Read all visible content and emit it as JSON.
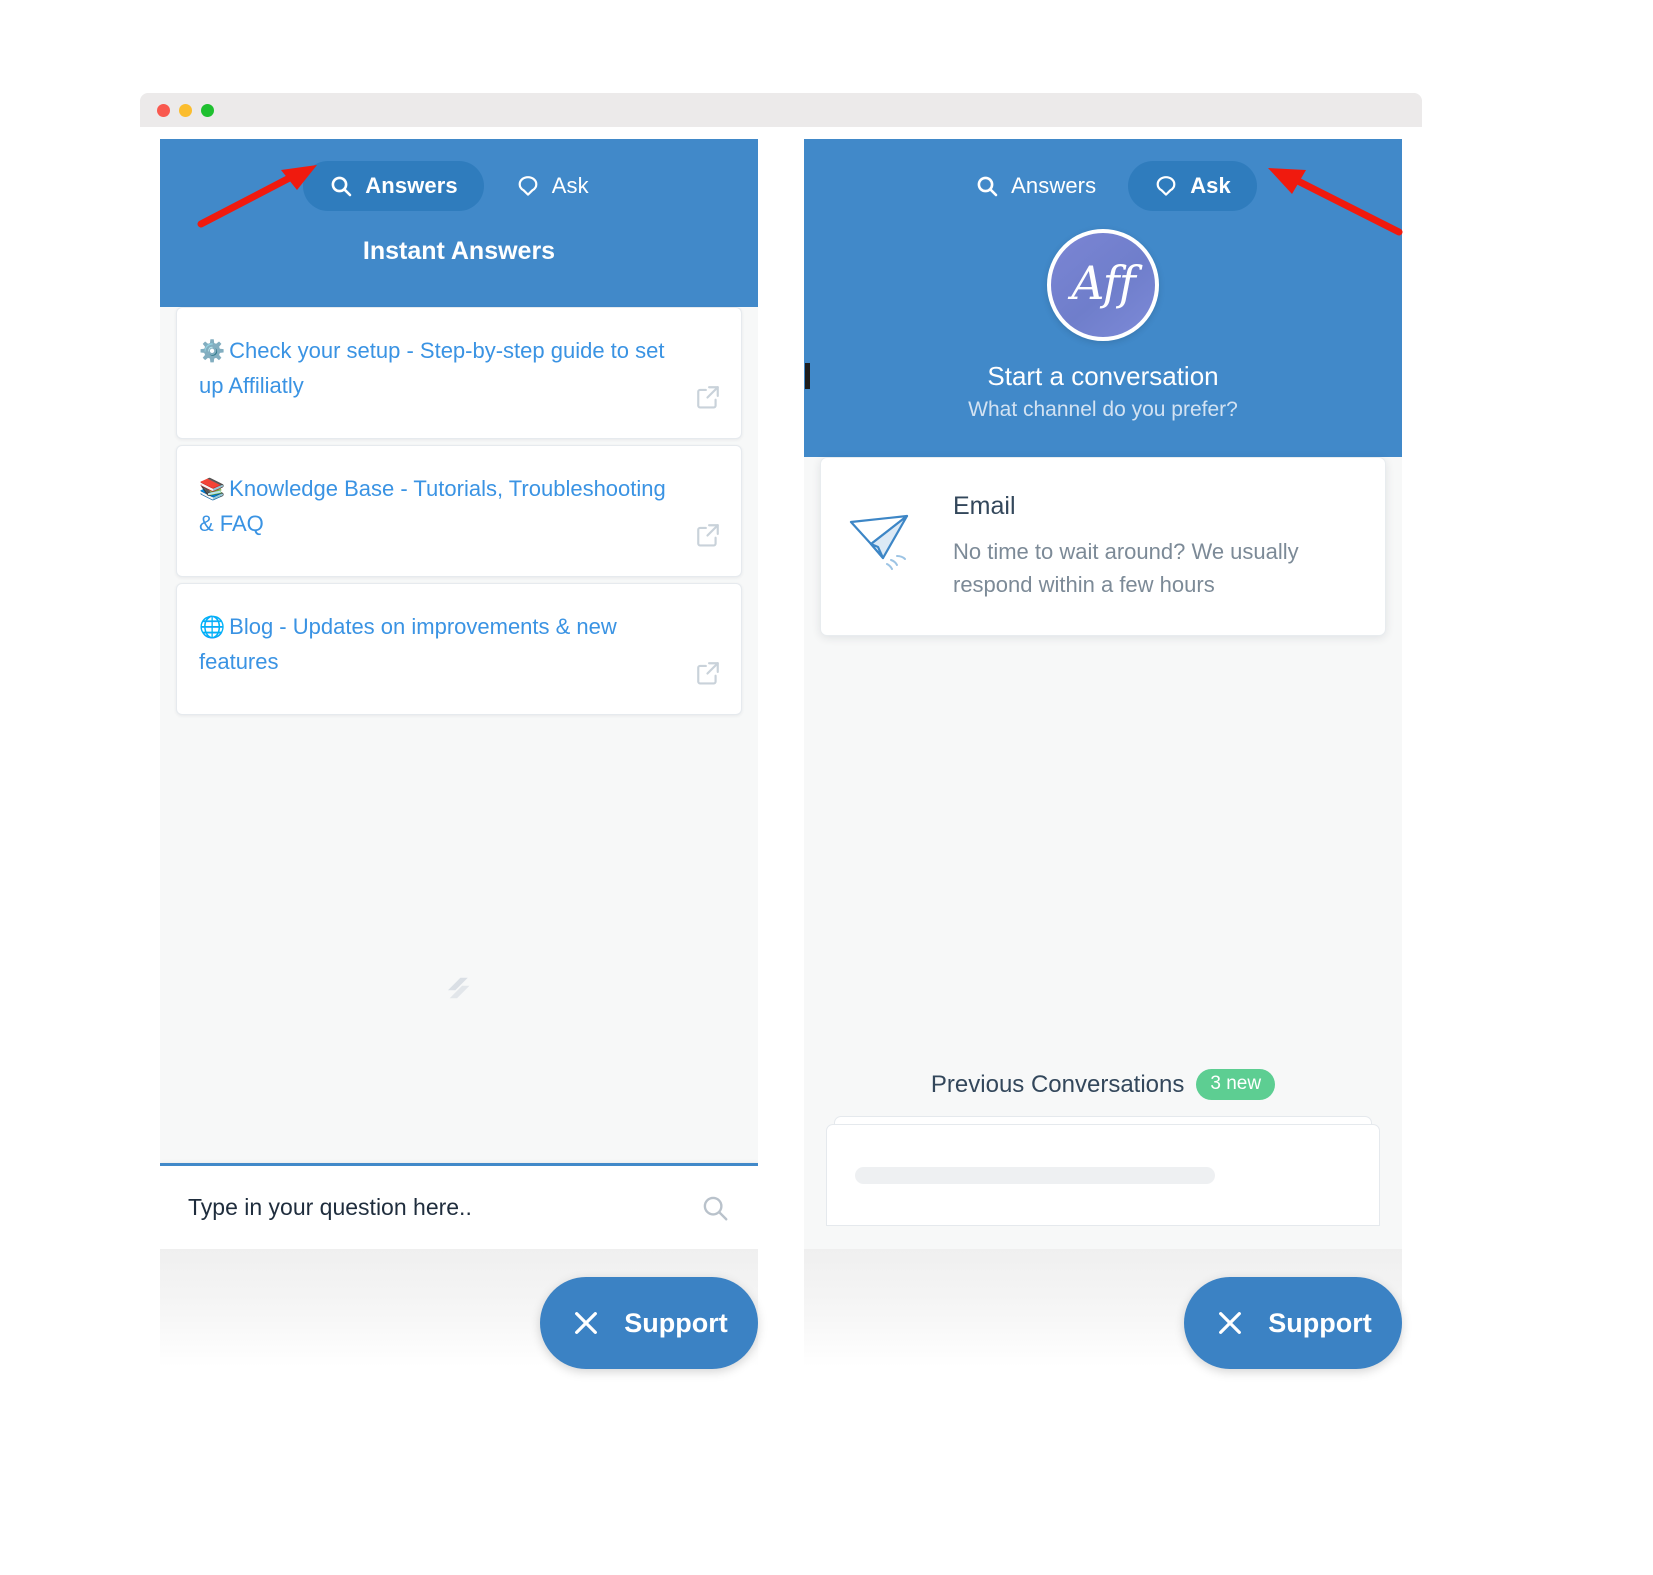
{
  "window": {
    "traffic_lights": [
      "close",
      "minimize",
      "maximize"
    ]
  },
  "left_panel": {
    "tabs": [
      {
        "id": "answers",
        "label": "Answers",
        "icon": "search-icon",
        "active": true
      },
      {
        "id": "ask",
        "label": "Ask",
        "icon": "chat-bubble-icon",
        "active": false
      }
    ],
    "title": "Instant Answers",
    "cards": [
      {
        "emoji": "⚙️",
        "text": "Check your setup - Step-by-step guide to set up Affiliatly",
        "action_icon": "external-link-icon"
      },
      {
        "emoji": "📚",
        "text": "Knowledge Base - Tutorials, Troubleshooting & FAQ",
        "action_icon": "external-link-icon"
      },
      {
        "emoji": "🌐",
        "text": "Blog - Updates on improvements & new features",
        "action_icon": "external-link-icon"
      }
    ],
    "watermark_icon": "helpscout-beacon-icon",
    "search": {
      "placeholder": "Type in your question here..",
      "value": "",
      "icon": "search-icon"
    },
    "launcher": {
      "label": "Support",
      "icon": "close-x-icon"
    }
  },
  "right_panel": {
    "tabs": [
      {
        "id": "answers",
        "label": "Answers",
        "icon": "search-icon",
        "active": false
      },
      {
        "id": "ask",
        "label": "Ask",
        "icon": "chat-bubble-icon",
        "active": true
      }
    ],
    "brand": {
      "logo_text": "Aff",
      "logo_name": "affiliatly-avatar"
    },
    "heading": "Start a conversation",
    "subheading": "What channel do you prefer?",
    "channels": [
      {
        "id": "email",
        "title": "Email",
        "description": "No time to wait around? We usually respond within a few hours",
        "icon": "paper-plane-icon"
      }
    ],
    "previous": {
      "label": "Previous Conversations",
      "badge": "3 new"
    },
    "launcher": {
      "label": "Support",
      "icon": "close-x-icon"
    }
  },
  "annotations": [
    {
      "id": "arrow-to-answers-tab",
      "shape": "red-arrow",
      "points_to": "Answers"
    },
    {
      "id": "arrow-to-ask-tab",
      "shape": "red-arrow",
      "points_to": "Ask"
    }
  ],
  "colors": {
    "header_blue": "#4189c9",
    "active_tab_blue": "#2f7cbd",
    "link_blue": "#3a93e3",
    "launcher_blue": "#3b82c4",
    "badge_green": "#5dce92",
    "annotation_red": "#f01a0e",
    "text_dark": "#33475b",
    "text_muted": "#7c8a97"
  }
}
